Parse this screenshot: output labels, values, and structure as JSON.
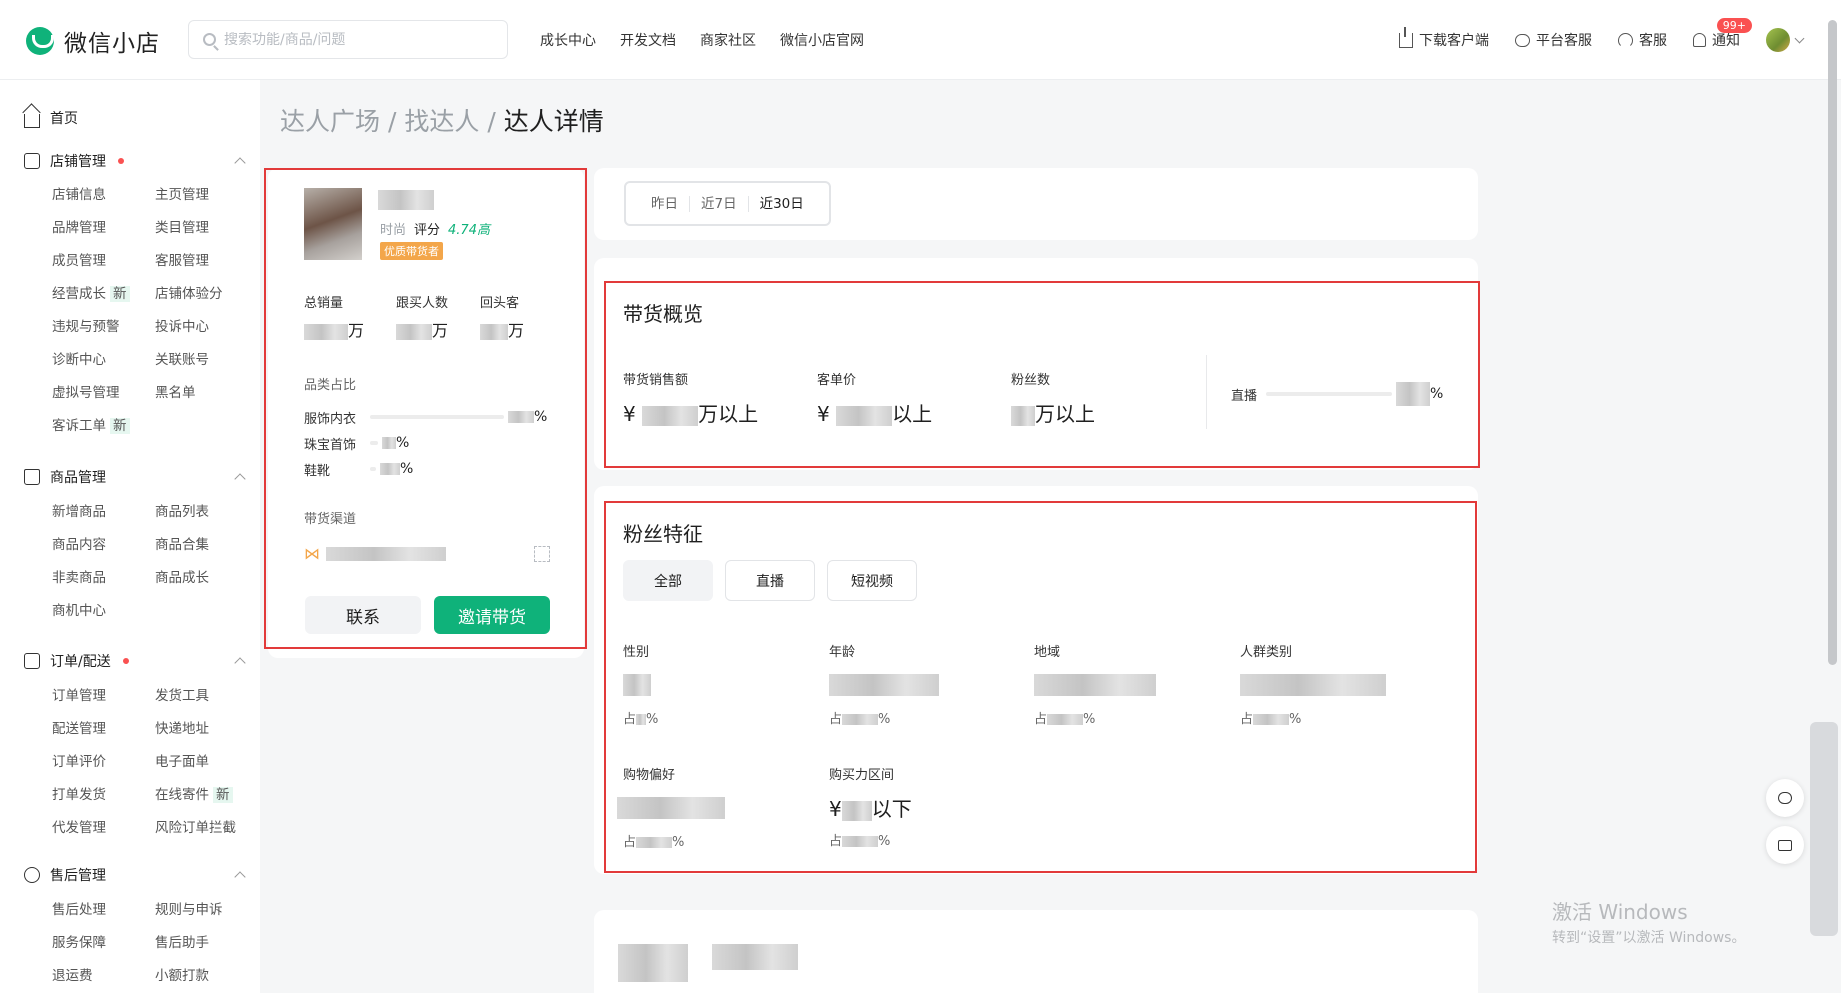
{
  "header": {
    "logo_text": "微信小店",
    "search_placeholder": "搜索功能/商品/问题",
    "nav": [
      "成长中心",
      "开发文档",
      "商家社区",
      "微信小店官网"
    ],
    "tools": {
      "download": "下载客户端",
      "platform_service": "平台客服",
      "service": "客服",
      "notify": "通知",
      "notify_badge": "99+"
    }
  },
  "sidebar": {
    "home": "首页",
    "groups": [
      {
        "title": "店铺管理",
        "items": [
          "店铺信息",
          "主页管理",
          "品牌管理",
          "类目管理",
          "成员管理",
          "客服管理",
          "经营成长",
          "店铺体验分",
          "违规与预警",
          "投诉中心",
          "诊断中心",
          "关联账号",
          "虚拟号管理",
          "黑名单",
          "客诉工单"
        ]
      },
      {
        "title": "商品管理",
        "items": [
          "新增商品",
          "商品列表",
          "商品内容",
          "商品合集",
          "非卖商品",
          "商品成长",
          "商机中心"
        ]
      },
      {
        "title": "订单/配送",
        "items": [
          "订单管理",
          "发货工具",
          "配送管理",
          "快递地址",
          "订单评价",
          "电子面单",
          "打单发货",
          "在线寄件",
          "代发管理",
          "风险订单拦截"
        ]
      },
      {
        "title": "售后管理",
        "items": [
          "售后处理",
          "规则与申诉",
          "服务保障",
          "售后助手",
          "退运费",
          "小额打款"
        ]
      }
    ],
    "new_tag": "新"
  },
  "breadcrumb": [
    "达人广场",
    "找达人",
    "达人详情"
  ],
  "breadcrumb_sep": "/",
  "profile": {
    "category": "时尚",
    "score_label": "评分",
    "score": "4.74高",
    "tag": "优质带货者",
    "stats": [
      {
        "label": "总销量",
        "unit": "万"
      },
      {
        "label": "跟买人数",
        "unit": "万"
      },
      {
        "label": "回头客",
        "unit": "万"
      }
    ],
    "category_share_title": "品类占比",
    "categories": [
      "服饰内衣",
      "珠宝首饰",
      "鞋靴"
    ],
    "percent": "%",
    "channel_title": "带货渠道",
    "contact_btn": "联系",
    "invite_btn": "邀请带货"
  },
  "period": {
    "options": [
      "昨日",
      "近7日",
      "近30日"
    ],
    "selected": "近30日"
  },
  "overview": {
    "title": "带货概览",
    "metrics": [
      {
        "label": "带货销售额",
        "prefix": "¥",
        "suffix": "万以上"
      },
      {
        "label": "客单价",
        "prefix": "¥",
        "suffix": "以上"
      },
      {
        "label": "粉丝数",
        "prefix": "",
        "suffix": "万以上"
      }
    ],
    "live_label": "直播",
    "percent": "%"
  },
  "fans": {
    "title": "粉丝特征",
    "tabs": [
      "全部",
      "直播",
      "短视频"
    ],
    "selected_tab": "全部",
    "attrs": [
      "性别",
      "年龄",
      "地域",
      "人群类别",
      "购物偏好",
      "购买力区间"
    ],
    "share_prefix": "占",
    "percent": "%",
    "price_prefix": "¥",
    "price_suffix": "以下"
  },
  "watermark": {
    "line1": "激活 Windows",
    "line2": "转到“设置”以激活 Windows。"
  },
  "colors": {
    "brand": "#0fb27a",
    "highlight_border": "#e23a3a",
    "badge": "#fa5151"
  }
}
